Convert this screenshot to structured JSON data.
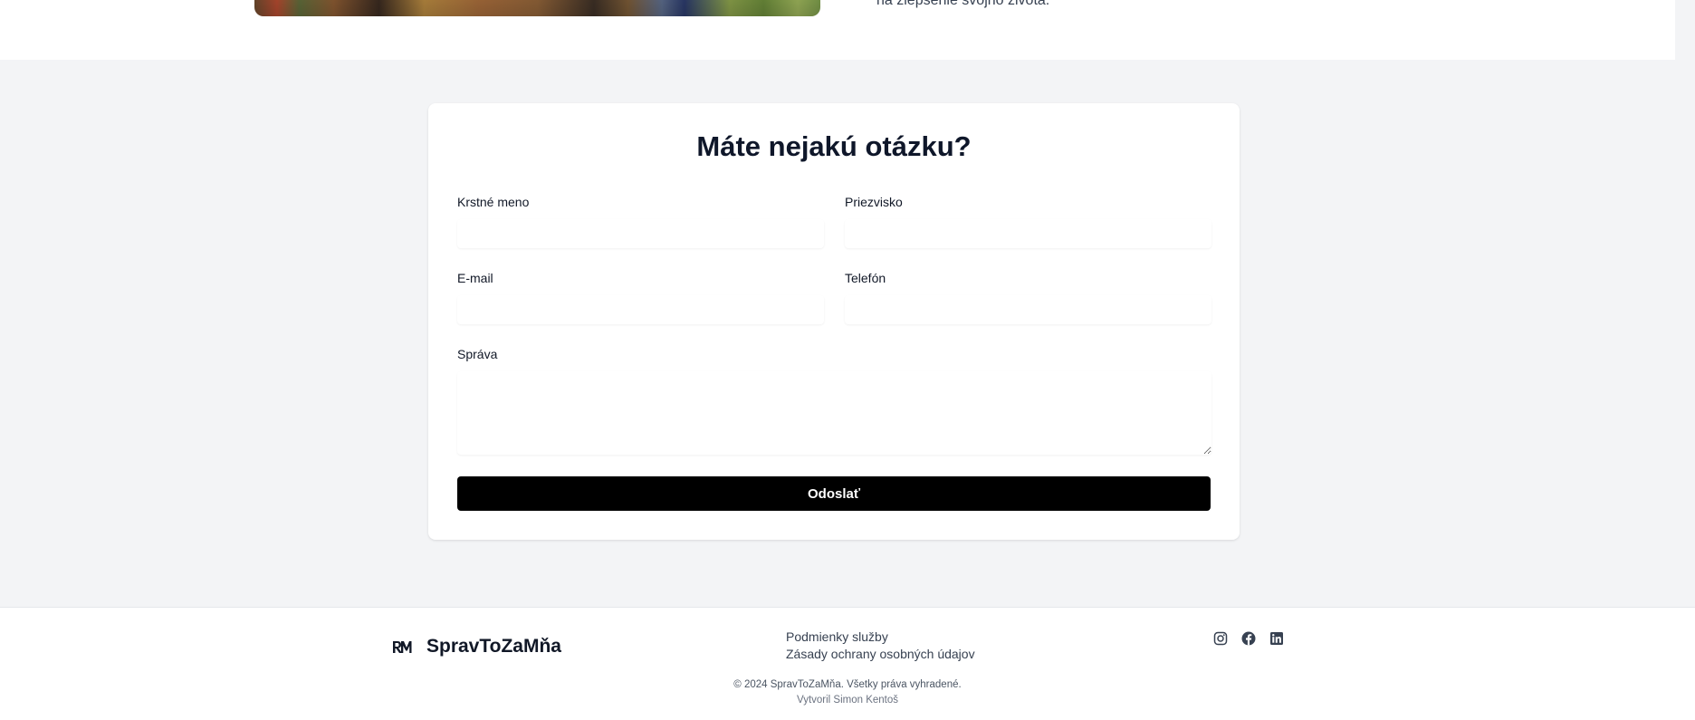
{
  "top_section": {
    "text": "na zlepšenie svojho života."
  },
  "form": {
    "title": "Máte nejakú otázku?",
    "first_name_label": "Krstné meno",
    "last_name_label": "Priezvisko",
    "email_label": "E-mail",
    "phone_label": "Telefón",
    "message_label": "Správa",
    "submit_label": "Odoslať"
  },
  "footer": {
    "brand": "SpravToZaMňa",
    "links": [
      "Podmienky služby",
      "Zásady ochrany osobných údajov"
    ],
    "socials": [
      "instagram-icon",
      "facebook-icon",
      "linkedin-icon"
    ],
    "copyright": "© 2024 SpravToZaMňa. Všetky práva vyhradené.",
    "credit": "Vytvoril Simon Kentoš"
  }
}
